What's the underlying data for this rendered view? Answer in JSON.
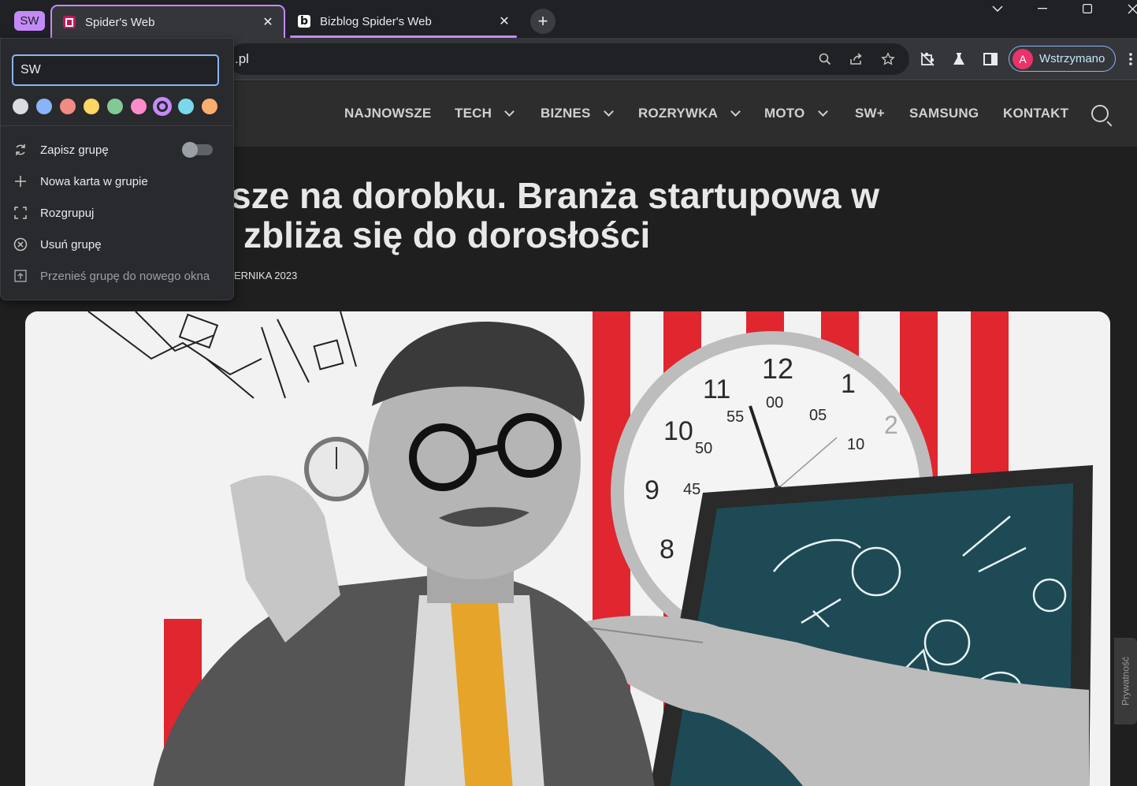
{
  "tab_group": {
    "chip_label": "SW",
    "color": "#c58af9"
  },
  "tabs": [
    {
      "title": "Spider's Web",
      "active": true,
      "favicon": "spiderweb-favicon"
    },
    {
      "title": "Bizblog Spider's Web",
      "active": false,
      "favicon": "bizblog-favicon"
    }
  ],
  "toolbar": {
    "url_fragment": ".pl",
    "profile_initial": "A",
    "profile_label": "Wstrzymano"
  },
  "group_editor": {
    "name_value": "SW",
    "colors": [
      "#dadce0",
      "#8ab4f8",
      "#f28b82",
      "#fdd663",
      "#81c995",
      "#ff8bcb",
      "#c58af9",
      "#78d9ec",
      "#fcad70"
    ],
    "selected_color_index": 6,
    "menu": {
      "save": "Zapisz grupę",
      "new_tab": "Nowa karta w grupie",
      "ungroup": "Rozgrupuj",
      "delete": "Usuń grupę",
      "move": "Przenieś grupę do nowego okna"
    },
    "save_toggle_on": false
  },
  "site": {
    "nav": {
      "najnowsze": "NAJNOWSZE",
      "tech": "TECH",
      "biznes": "BIZNES",
      "rozrywka": "ROZRYWKA",
      "moto": "MOTO",
      "swplus": "SW+",
      "samsung": "SAMSUNG",
      "kontakt": "KONTAKT"
    },
    "headline_line1": "sze na dorobku. Branża startupowa w",
    "headline_line2": "zbliża się do dorosłości",
    "date": "ERNIKA 2023",
    "privacy_label": "Prywatność",
    "clock_numbers": [
      "12",
      "1",
      "2",
      "11",
      "10",
      "9",
      "8",
      "00",
      "05",
      "10",
      "55",
      "50",
      "45"
    ]
  }
}
